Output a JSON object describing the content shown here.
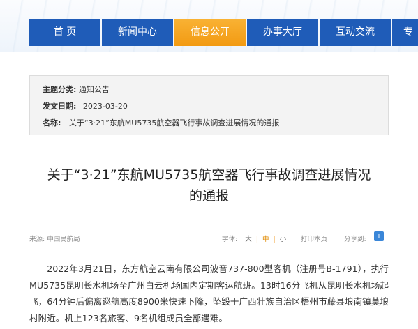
{
  "nav": {
    "items": [
      {
        "label": "首 页"
      },
      {
        "label": "新闻中心"
      },
      {
        "label": "信息公开"
      },
      {
        "label": "办事大厅"
      },
      {
        "label": "互动交流"
      },
      {
        "label": "专"
      }
    ],
    "active_index": 2
  },
  "meta": {
    "category_key": "主题分类:",
    "category_value": "通知公告",
    "date_key": "发文日期:",
    "date_value": "2023-03-20",
    "name_key": "名称:",
    "name_value": "关于“3·21”东航MU5735航空器飞行事故调查进展情况的通报"
  },
  "article": {
    "title_line1": "关于“3·21”东航MU5735航空器飞行事故调查进展情况",
    "title_line2": "的通报",
    "source": "来源: 中国民航局",
    "font_label": "字体:",
    "font_large": "大",
    "font_medium": "中",
    "font_small": "小",
    "print_label": "打印本页",
    "share_label": "分享到:",
    "share_icon": "+",
    "paragraph": "2022年3月21日，东方航空云南有限公司波音737-800型客机（注册号B-1791），执行MU5735昆明长水机场至广州白云机场国内定期客运航班。13时16分飞机从昆明长水机场起飞，64分钟后偏离巡航高度8900米快速下降，坠毁于广西壮族自治区梧州市藤县埌南镇莫埌村附近。机上123名旅客、9名机组成员全部遇难。"
  },
  "colors": {
    "nav_blue": "#1f5cb8",
    "nav_active": "#f29a12"
  }
}
